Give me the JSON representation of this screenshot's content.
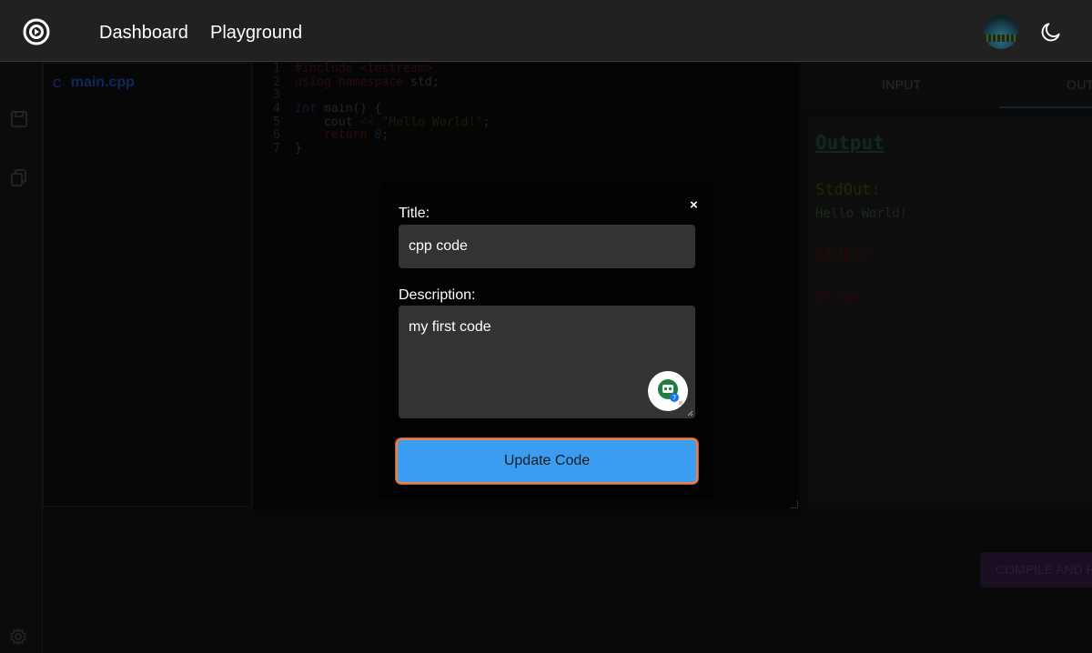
{
  "navbar": {
    "links": [
      "Dashboard",
      "Playground"
    ]
  },
  "files": [
    {
      "name": "main.cpp",
      "icon": "cpp-file-icon"
    }
  ],
  "editor": {
    "line_numbers": [
      "1",
      "2",
      "3",
      "4",
      "5",
      "6",
      "7"
    ],
    "lines": [
      [
        {
          "t": "#include <iostream>",
          "c": "kw"
        }
      ],
      [
        {
          "t": "using namespace ",
          "c": "kw"
        },
        {
          "t": "std;",
          "c": "ct"
        }
      ],
      [
        {
          "t": "",
          "c": "ct"
        }
      ],
      [
        {
          "t": "int",
          "c": "kw-int"
        },
        {
          "t": " main() {",
          "c": "ct"
        }
      ],
      [
        {
          "t": "    cout ",
          "c": "ct"
        },
        {
          "t": "<<",
          "c": "kw"
        },
        {
          "t": " ",
          "c": "ct"
        },
        {
          "t": "\"Hello World!\"",
          "c": "str"
        },
        {
          "t": ";",
          "c": "ct"
        }
      ],
      [
        {
          "t": "    return ",
          "c": "kw"
        },
        {
          "t": "0",
          "c": "kw-int"
        },
        {
          "t": ";",
          "c": "ct"
        }
      ],
      [
        {
          "t": "}",
          "c": "ct"
        }
      ]
    ]
  },
  "io": {
    "tabs": [
      "INPUT",
      "OUTPUT"
    ],
    "active_tab": "OUTPUT",
    "heading": "Output",
    "stdout_label": "StdOut:",
    "stdout_value": "Hello World!",
    "stderr_label": "StdErr:",
    "error_label": "Error:"
  },
  "compile_button": "COMPILE AND RUN",
  "modal": {
    "close": "×",
    "title_label": "Title:",
    "title_value": "cpp code",
    "description_label": "Description:",
    "description_value": "my first code",
    "submit": "Update Code"
  },
  "colors": {
    "nav_bg": "#212121",
    "button_blue": "#3a9df1",
    "focus_ring": "#e8804f"
  }
}
